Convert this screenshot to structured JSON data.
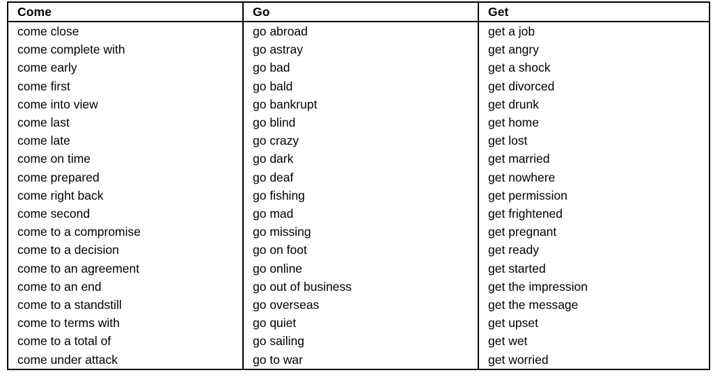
{
  "document": {
    "type": "collocations-table",
    "background_color": "#ffffff",
    "text_color": "#000000",
    "border_color": "#000000"
  },
  "table": {
    "columns": [
      {
        "key": "come",
        "header": "Come"
      },
      {
        "key": "go",
        "header": "Go"
      },
      {
        "key": "get",
        "header": "Get"
      }
    ],
    "rows": [
      {
        "come": "come close",
        "go": "go abroad",
        "get": "get a job"
      },
      {
        "come": "come complete with",
        "go": "go astray",
        "get": "get angry"
      },
      {
        "come": "come early",
        "go": "go bad",
        "get": "get a shock"
      },
      {
        "come": "come first",
        "go": "go bald",
        "get": "get divorced"
      },
      {
        "come": "come into view",
        "go": "go bankrupt",
        "get": "get drunk"
      },
      {
        "come": "come last",
        "go": "go blind",
        "get": "get home"
      },
      {
        "come": "come late",
        "go": "go crazy",
        "get": "get lost"
      },
      {
        "come": "come on time",
        "go": "go dark",
        "get": "get married"
      },
      {
        "come": "come prepared",
        "go": "go deaf",
        "get": "get nowhere"
      },
      {
        "come": "come right back",
        "go": "go fishing",
        "get": "get permission"
      },
      {
        "come": "come second",
        "go": "go mad",
        "get": "get frightened"
      },
      {
        "come": "come to a compromise",
        "go": "go missing",
        "get": "get pregnant"
      },
      {
        "come": "come to a decision",
        "go": "go on foot",
        "get": "get ready"
      },
      {
        "come": "come to an agreement",
        "go": "go online",
        "get": "get started"
      },
      {
        "come": "come to an end",
        "go": "go out of business",
        "get": "get the impression"
      },
      {
        "come": "come to a standstill",
        "go": "go overseas",
        "get": "get the message"
      },
      {
        "come": "come to terms with",
        "go": "go quiet",
        "get": "get upset"
      },
      {
        "come": "come to a total of",
        "go": "go sailing",
        "get": "get wet"
      },
      {
        "come": "come under attack",
        "go": "go to war",
        "get": "get worried"
      }
    ]
  }
}
